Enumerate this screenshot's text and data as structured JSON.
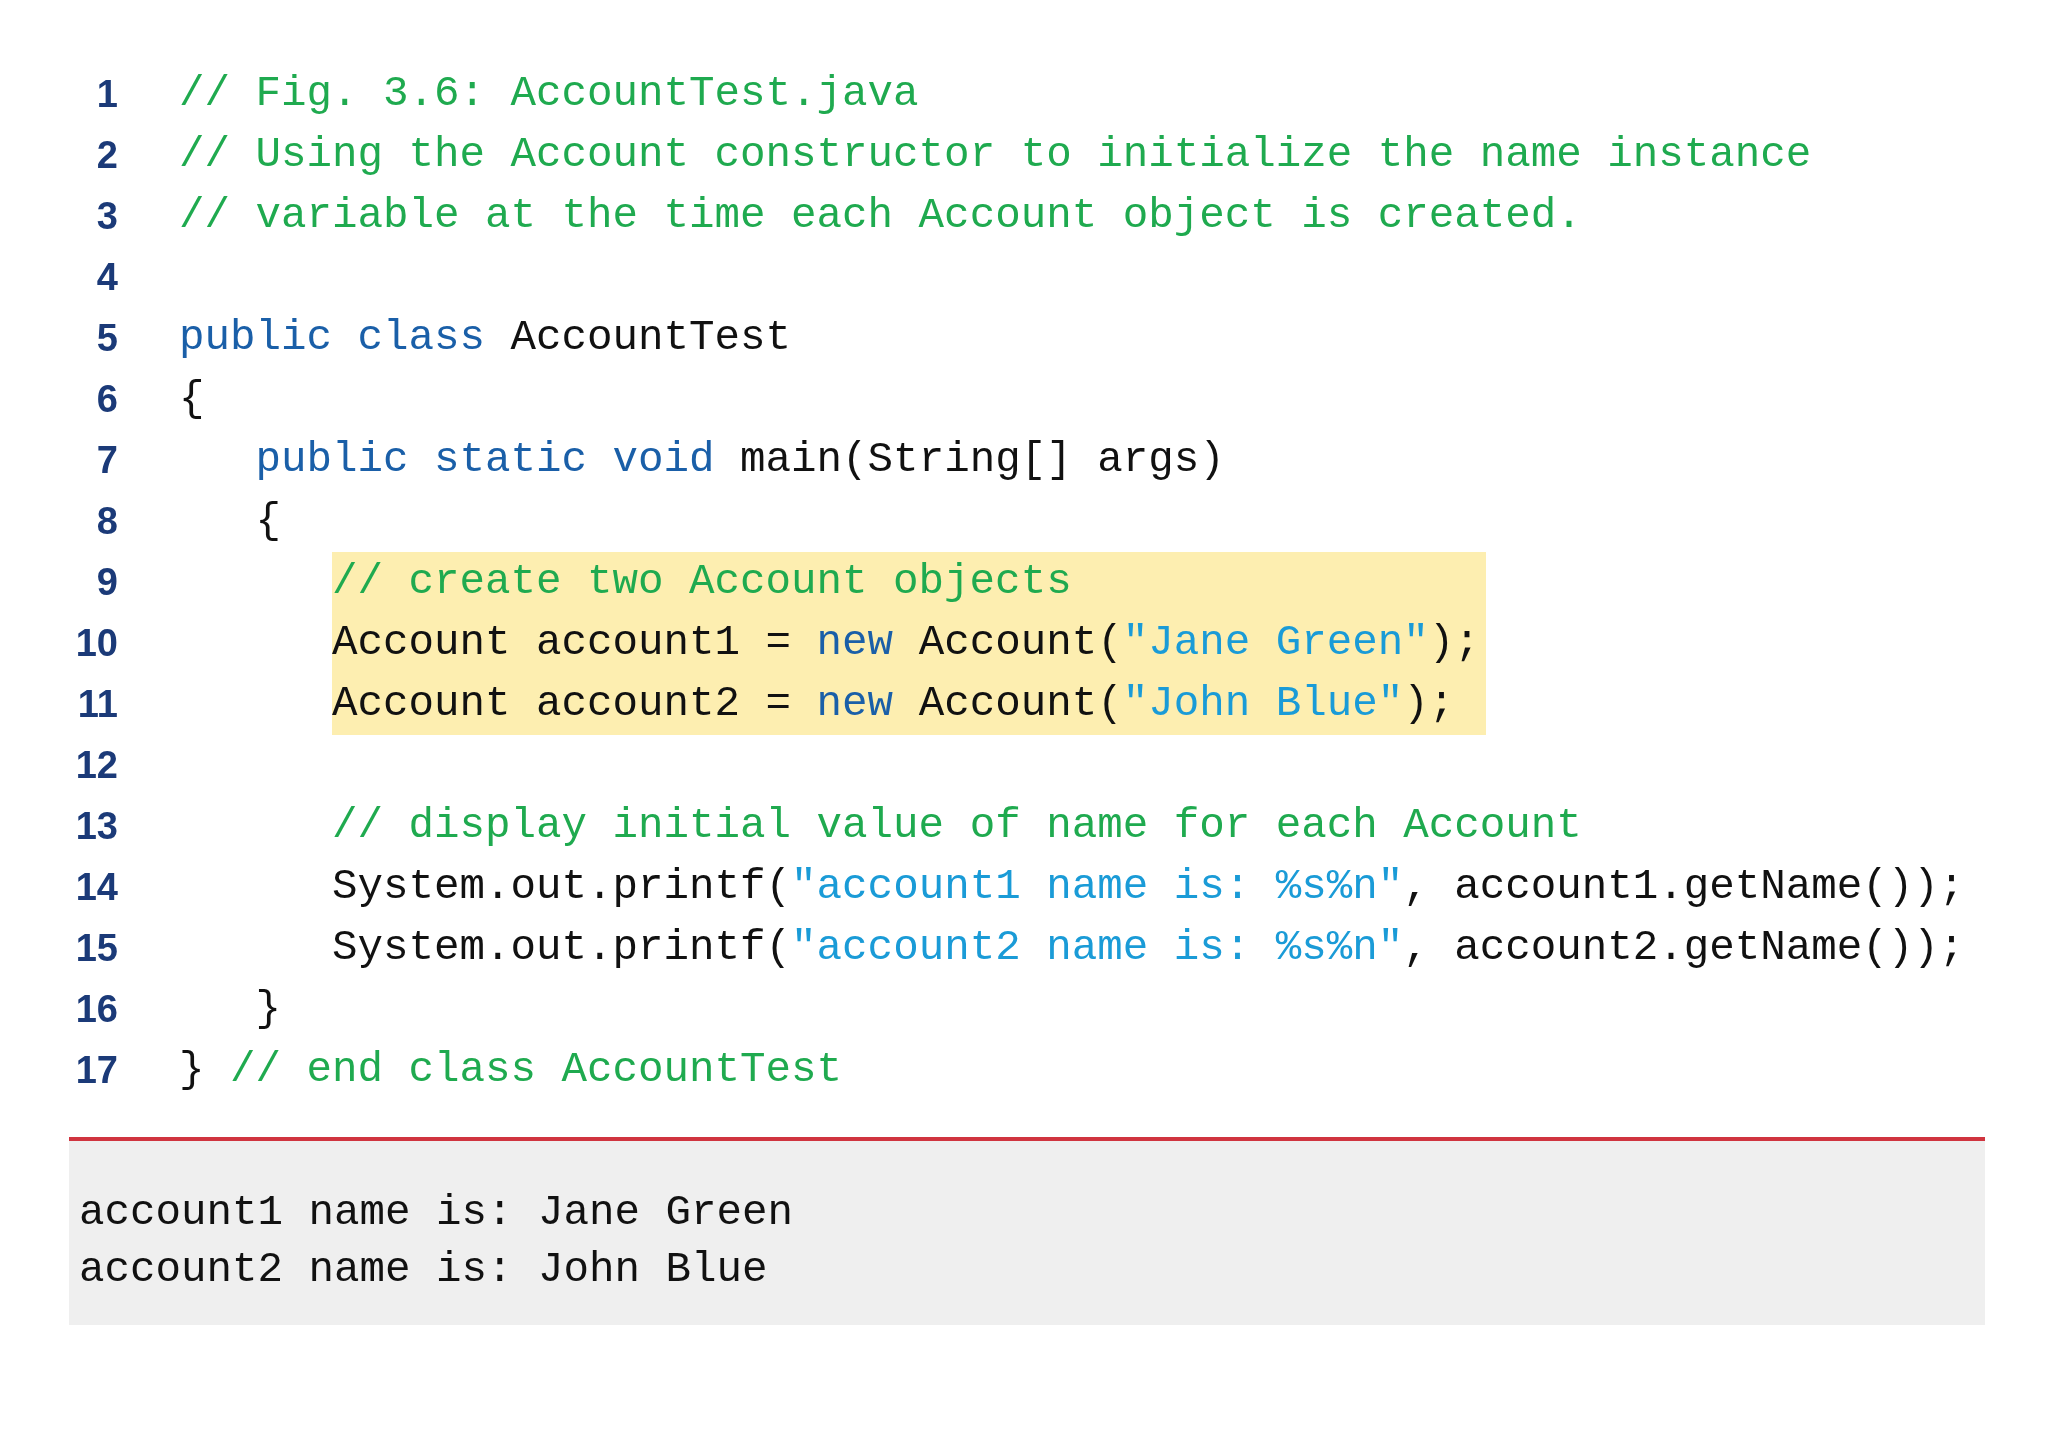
{
  "code_lines": [
    {
      "number": "1",
      "highlighted": false,
      "tokens": [
        {
          "kind": "comment",
          "text": "// Fig. 3.6: AccountTest.java"
        }
      ]
    },
    {
      "number": "2",
      "highlighted": false,
      "tokens": [
        {
          "kind": "comment",
          "text": "// Using the Account constructor to initialize the name instance"
        }
      ]
    },
    {
      "number": "3",
      "highlighted": false,
      "tokens": [
        {
          "kind": "comment",
          "text": "// variable at the time each Account object is created."
        }
      ]
    },
    {
      "number": "4",
      "highlighted": false
    },
    {
      "number": "5",
      "highlighted": false,
      "tokens": [
        {
          "kind": "keyword",
          "text": "public class"
        },
        {
          "kind": "plain",
          "text": " AccountTest"
        }
      ]
    },
    {
      "number": "6",
      "highlighted": false,
      "tokens": [
        {
          "kind": "plain",
          "text": "{"
        }
      ]
    },
    {
      "number": "7",
      "highlighted": false,
      "tokens": [
        {
          "kind": "keyword",
          "text": "   public static void"
        },
        {
          "kind": "plain",
          "text": " main(String[] args)"
        }
      ]
    },
    {
      "number": "8",
      "highlighted": false,
      "tokens": [
        {
          "kind": "plain",
          "text": "   {"
        }
      ]
    },
    {
      "number": "9",
      "highlighted": true,
      "tokens": [
        {
          "kind": "comment",
          "text": "      // create two Account objects"
        }
      ]
    },
    {
      "number": "10",
      "highlighted": true,
      "tokens": [
        {
          "kind": "plain",
          "text": "      Account account1 = "
        },
        {
          "kind": "keyword",
          "text": "new"
        },
        {
          "kind": "plain",
          "text": " Account("
        },
        {
          "kind": "string",
          "text": "\"Jane Green\""
        },
        {
          "kind": "plain",
          "text": ");"
        }
      ]
    },
    {
      "number": "11",
      "highlighted": true,
      "tokens": [
        {
          "kind": "plain",
          "text": "      Account account2 = "
        },
        {
          "kind": "keyword",
          "text": "new"
        },
        {
          "kind": "plain",
          "text": " Account("
        },
        {
          "kind": "string",
          "text": "\"John Blue\""
        },
        {
          "kind": "plain",
          "text": ");"
        }
      ]
    },
    {
      "number": "12",
      "highlighted": false
    },
    {
      "number": "13",
      "highlighted": false,
      "tokens": [
        {
          "kind": "comment",
          "text": "      // display initial value of name for each Account"
        }
      ]
    },
    {
      "number": "14",
      "highlighted": false,
      "tokens": [
        {
          "kind": "plain",
          "text": "      System.out.printf("
        },
        {
          "kind": "string",
          "text": "\"account1 name is: %s%n\""
        },
        {
          "kind": "plain",
          "text": ", account1.getName());"
        }
      ]
    },
    {
      "number": "15",
      "highlighted": false,
      "tokens": [
        {
          "kind": "plain",
          "text": "      System.out.printf("
        },
        {
          "kind": "string",
          "text": "\"account2 name is: %s%n\""
        },
        {
          "kind": "plain",
          "text": ", account2.getName());"
        }
      ]
    },
    {
      "number": "16",
      "highlighted": false,
      "tokens": [
        {
          "kind": "plain",
          "text": "   }"
        }
      ]
    },
    {
      "number": "17",
      "highlighted": false,
      "tokens": [
        {
          "kind": "plain",
          "text": "} "
        },
        {
          "kind": "comment",
          "text": "// end class AccountTest"
        }
      ]
    }
  ],
  "output": [
    "account1 name is: Jane Green",
    "account2 name is: John Blue"
  ]
}
